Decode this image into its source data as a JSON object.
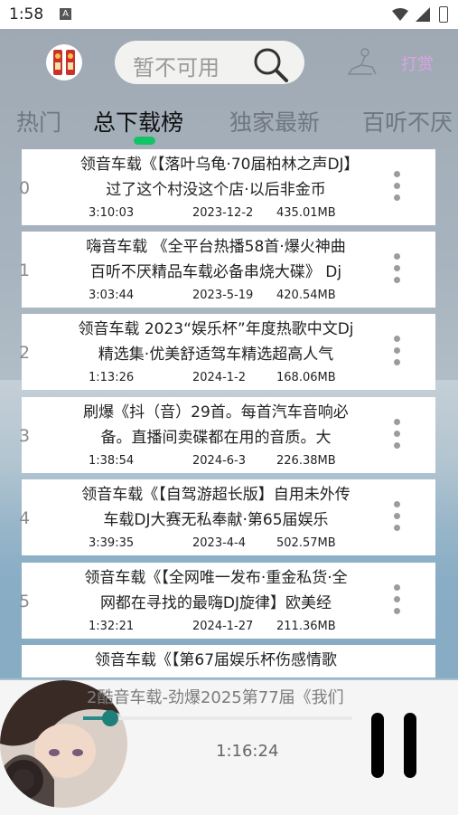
{
  "status_bar": {
    "time": "1:58",
    "notification_letter": "A"
  },
  "header": {
    "search_placeholder": "暂不可用",
    "right_link": "打赏"
  },
  "tabs": [
    {
      "label": "热门",
      "active": false
    },
    {
      "label": "总下载榜",
      "active": true
    },
    {
      "label": "独家最新",
      "active": false
    },
    {
      "label": "百听不厌",
      "active": false
    }
  ],
  "tracks": [
    {
      "index": "0",
      "title": "领音车载《【落叶乌龟·70届柏林之声DJ】过了这个村没这个店·以后非金币",
      "duration": "3:10:03",
      "date": "2023-12-2",
      "size": "435.01MB"
    },
    {
      "index": "1",
      "title": "嗨音车载 《全平台热播58首·爆火神曲 百听不厌精品车载必备串烧大碟》 Dj",
      "duration": "3:03:44",
      "date": "2023-5-19",
      "size": "420.54MB"
    },
    {
      "index": "2",
      "title": "领音车载 2023“娱乐杯”年度热歌中文Dj精选集·优美舒适驾车精选超高人气",
      "duration": "1:13:26",
      "date": "2024-1-2",
      "size": "168.06MB"
    },
    {
      "index": "3",
      "title": "刷爆《抖（音）29首。每首汽车音响必备。直播间卖碟都在用的音质。大",
      "duration": "1:38:54",
      "date": "2024-6-3",
      "size": "226.38MB"
    },
    {
      "index": "4",
      "title": "领音车载《【自驾游超长版】自用未外传车载DJ大赛无私奉献·第65届娱乐",
      "duration": "3:39:35",
      "date": "2023-4-4",
      "size": "502.57MB"
    },
    {
      "index": "5",
      "title": "领音车载《【全网唯一发布·重金私货·全网都在寻找的最嗨DJ旋律】欧美经",
      "duration": "1:32:21",
      "date": "2024-1-27",
      "size": "211.36MB"
    },
    {
      "index": "",
      "title": "领音车载《【第67届娱乐杯伤感情歌",
      "duration": "",
      "date": "",
      "size": ""
    }
  ],
  "player": {
    "now_playing": "2酷音车载-劲爆2025第77届《我们",
    "elapsed": "1:16:24",
    "progress_fraction": 0.1
  },
  "colors": {
    "accent_green": "#13c466",
    "progress": "#1f7f7a",
    "link": "#d9a3e4"
  }
}
